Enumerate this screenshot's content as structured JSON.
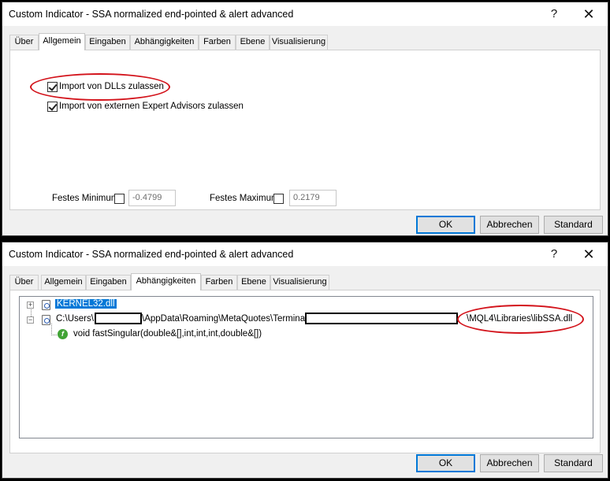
{
  "dialog_top": {
    "title": "Custom Indicator - SSA normalized end-pointed & alert advanced",
    "tabs": [
      "Über",
      "Allgemein",
      "Eingaben",
      "Abhängigkeiten",
      "Farben",
      "Ebene",
      "Visualisierung"
    ],
    "active_tab": "Allgemein",
    "checkbox_dll": {
      "label": "Import von DLLs zulassen",
      "checked": true
    },
    "checkbox_ea": {
      "label": "Import von externen Expert Advisors zulassen",
      "checked": true
    },
    "fixed_min": {
      "label": "Festes Minimum",
      "checked": false,
      "value": "-0.4799"
    },
    "fixed_max": {
      "label": "Festes Maximum",
      "checked": false,
      "value": "0.2179"
    },
    "buttons": {
      "ok": "OK",
      "cancel": "Abbrechen",
      "default": "Standard"
    }
  },
  "dialog_bottom": {
    "title": "Custom Indicator - SSA normalized end-pointed & alert advanced",
    "tabs": [
      "Über",
      "Allgemein",
      "Eingaben",
      "Abhängigkeiten",
      "Farben",
      "Ebene",
      "Visualisierung"
    ],
    "active_tab": "Abhängigkeiten",
    "tree": {
      "item1": "KERNEL32.dll",
      "item2_prefix": "C:\\Users\\",
      "item2_mid": "\\AppData\\Roaming\\MetaQuotes\\Terminal\\",
      "item2_suffix": "\\MQL4\\Libraries\\libSSA.dll",
      "child": "void fastSingular(double&[],int,int,int,double&[])"
    },
    "buttons": {
      "ok": "OK",
      "cancel": "Abbrechen",
      "default": "Standard"
    }
  },
  "titlebar": {
    "help": "?",
    "close": "✕"
  },
  "icons": {
    "expand": "+",
    "collapse": "−",
    "function": "f"
  },
  "colors": {
    "selection": "#0078d7",
    "annotation": "#d3131b",
    "function_icon": "#41a335"
  }
}
